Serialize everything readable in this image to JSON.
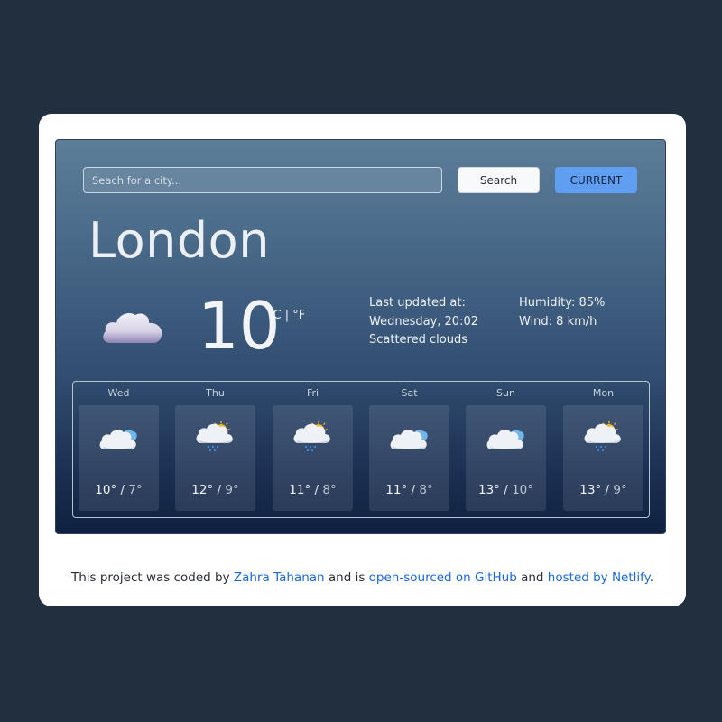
{
  "search": {
    "placeholder": "Seach for a city...",
    "button_label": "Search",
    "current_label": "CURRENT"
  },
  "current": {
    "city": "London",
    "temperature": "10",
    "unit_c": "°C",
    "unit_sep": " | ",
    "unit_f": "°F",
    "icon": "cloud-icon",
    "last_updated_label": "Last updated at:",
    "last_updated_value": "Wednesday, 20:02",
    "description": "Scattered clouds",
    "humidity": "Humidity: 85%",
    "wind": "Wind: 8 km/h"
  },
  "forecast": [
    {
      "day": "Wed",
      "max": "10°",
      "min": "7°",
      "icon": "cloudy-icon"
    },
    {
      "day": "Thu",
      "max": "12°",
      "min": "9°",
      "icon": "sun-cloud-rain-icon"
    },
    {
      "day": "Fri",
      "max": "11°",
      "min": "8°",
      "icon": "sun-cloud-rain-icon"
    },
    {
      "day": "Sat",
      "max": "11°",
      "min": "8°",
      "icon": "cloudy-icon"
    },
    {
      "day": "Sun",
      "max": "13°",
      "min": "10°",
      "icon": "cloudy-icon"
    },
    {
      "day": "Mon",
      "max": "13°",
      "min": "9°",
      "icon": "sun-cloud-rain-icon"
    }
  ],
  "forecast_separator": " / ",
  "footer": {
    "text1": "This project was coded by ",
    "link1": "Zahra Tahanan",
    "text2": " and is ",
    "link2": "open-sourced on GitHub",
    "text3": " and ",
    "link3": "hosted by Netlify",
    "text4": "."
  },
  "colors": {
    "background": "#212f3f",
    "accent": "#5f9ef1",
    "link": "#1a67d6"
  }
}
